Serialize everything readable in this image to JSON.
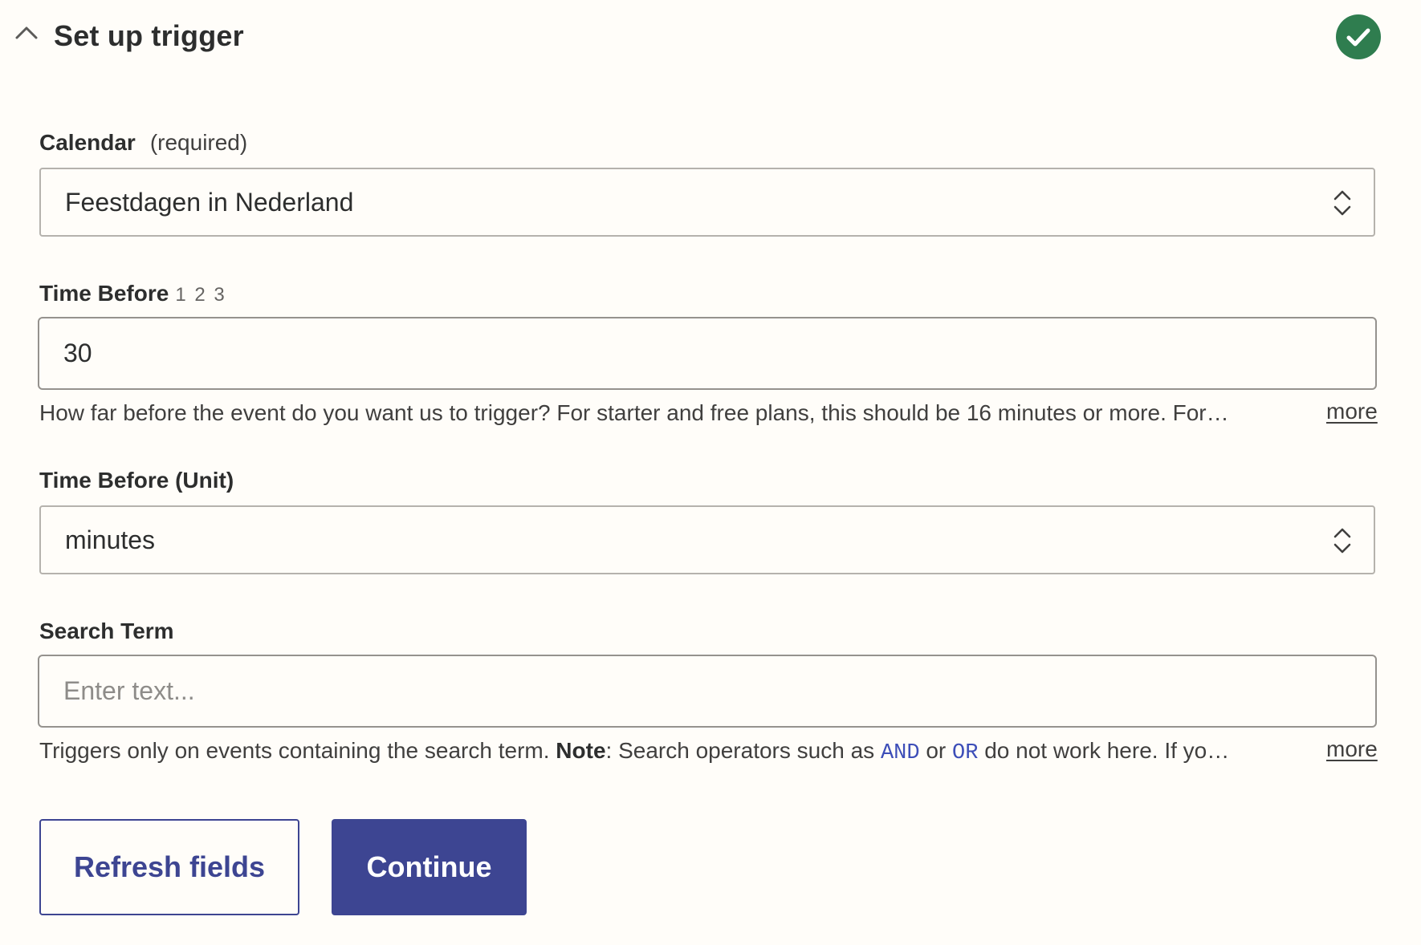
{
  "section": {
    "title": "Set up trigger",
    "status_color": "#2f7d4f"
  },
  "fields": {
    "calendar": {
      "label": "Calendar",
      "required": "(required)",
      "value": "Feestdagen in Nederland"
    },
    "time_before": {
      "label": "Time Before",
      "type_hint": "1 2 3",
      "value": "30",
      "help": "How far before the event do you want us to trigger? For starter and free plans, this should be 16 minutes or more. For…",
      "more": "more"
    },
    "time_before_unit": {
      "label": "Time Before (Unit)",
      "value": "minutes"
    },
    "search_term": {
      "label": "Search Term",
      "placeholder": "Enter text...",
      "help_prefix": "Triggers only on events containing the search term. ",
      "help_note": "Note",
      "help_mid1": ": Search operators such as ",
      "help_and": "AND",
      "help_mid2": " or ",
      "help_or": "OR",
      "help_suffix": " do not work here. If yo…",
      "more": "more"
    }
  },
  "actions": {
    "refresh_label": "Refresh fields",
    "continue_label": "Continue",
    "primary_color": "#3d4592"
  }
}
